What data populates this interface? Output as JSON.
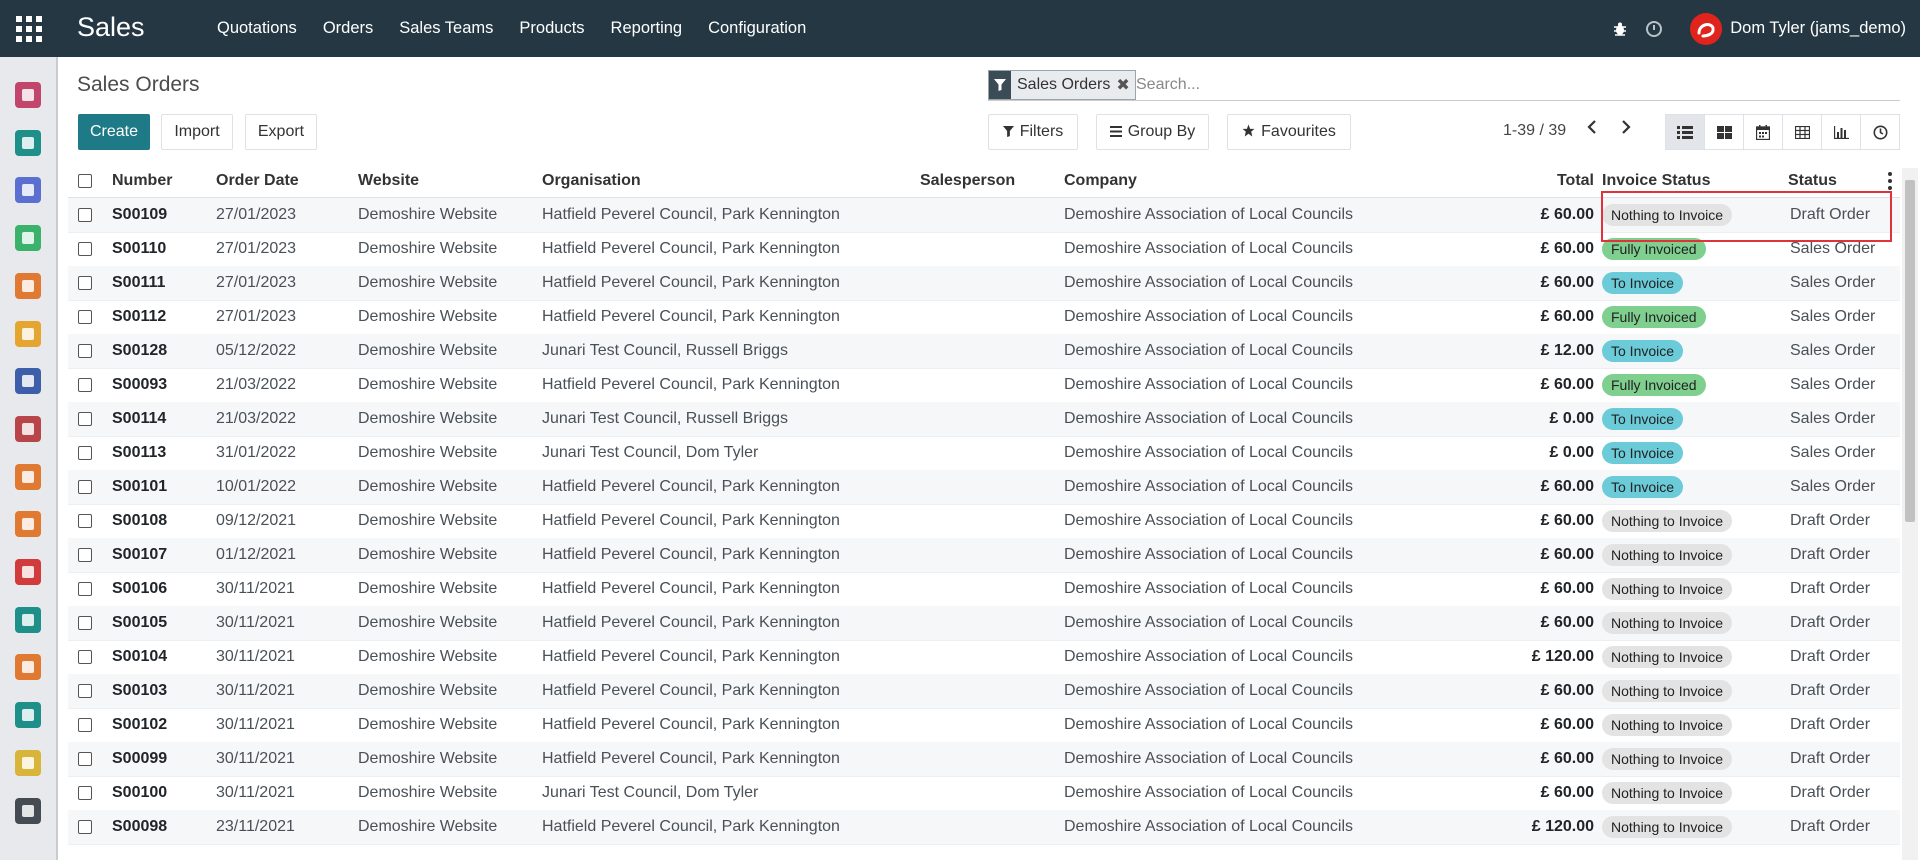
{
  "app": {
    "title": "Sales",
    "menu": [
      "Quotations",
      "Orders",
      "Sales Teams",
      "Products",
      "Reporting",
      "Configuration"
    ],
    "user": "Dom Tyler (jams_demo)"
  },
  "sidebar": {
    "items": [
      {
        "icon": "dashboard-icon",
        "color": "#c2466b"
      },
      {
        "icon": "contacts-icon",
        "color": "#1f8f8a"
      },
      {
        "icon": "team-icon",
        "color": "#5b6fd1"
      },
      {
        "icon": "members-icon",
        "color": "#3bb26b"
      },
      {
        "icon": "website-icon",
        "color": "#e07a33"
      },
      {
        "icon": "crm-icon",
        "color": "#e5a531"
      },
      {
        "icon": "knowledge-icon",
        "color": "#3d5ea8"
      },
      {
        "icon": "sales-icon",
        "color": "#b8454a"
      },
      {
        "icon": "reporting-icon",
        "color": "#e07a33"
      },
      {
        "icon": "invoicing-icon",
        "color": "#e07a33"
      },
      {
        "icon": "marketing-icon",
        "color": "#d23b3b"
      },
      {
        "icon": "pricing-icon",
        "color": "#1f8f8a"
      },
      {
        "icon": "surveys-icon",
        "color": "#e07a33"
      },
      {
        "icon": "employees-icon",
        "color": "#1f8f8a"
      },
      {
        "icon": "documents-icon",
        "color": "#d9b43a"
      },
      {
        "icon": "settings-icon",
        "color": "#444b52"
      }
    ]
  },
  "control": {
    "page_title": "Sales Orders",
    "facet_label": "Sales Orders",
    "facet_close": "✖",
    "search_placeholder": "Search...",
    "create_label": "Create",
    "import_label": "Import",
    "export_label": "Export",
    "filters_label": "Filters",
    "groupby_label": "Group By",
    "favourites_label": "Favourites",
    "pager": "1-39 / 39"
  },
  "table": {
    "headers": {
      "number": "Number",
      "order_date": "Order Date",
      "website": "Website",
      "organisation": "Organisation",
      "salesperson": "Salesperson",
      "company": "Company",
      "total": "Total",
      "invoice_status": "Invoice Status",
      "status": "Status"
    },
    "rows": [
      {
        "number": "S00109",
        "date": "27/01/2023",
        "website": "Demoshire Website",
        "org": "Hatfield Peverel Council, Park Kennington",
        "salesperson": "",
        "company": "Demoshire Association of Local Councils",
        "total": "£ 60.00",
        "invoice": "Nothing to Invoice",
        "status": "Draft Order"
      },
      {
        "number": "S00110",
        "date": "27/01/2023",
        "website": "Demoshire Website",
        "org": "Hatfield Peverel Council, Park Kennington",
        "salesperson": "",
        "company": "Demoshire Association of Local Councils",
        "total": "£ 60.00",
        "invoice": "Fully Invoiced",
        "status": "Sales Order"
      },
      {
        "number": "S00111",
        "date": "27/01/2023",
        "website": "Demoshire Website",
        "org": "Hatfield Peverel Council, Park Kennington",
        "salesperson": "",
        "company": "Demoshire Association of Local Councils",
        "total": "£ 60.00",
        "invoice": "To Invoice",
        "status": "Sales Order"
      },
      {
        "number": "S00112",
        "date": "27/01/2023",
        "website": "Demoshire Website",
        "org": "Hatfield Peverel Council, Park Kennington",
        "salesperson": "",
        "company": "Demoshire Association of Local Councils",
        "total": "£ 60.00",
        "invoice": "Fully Invoiced",
        "status": "Sales Order"
      },
      {
        "number": "S00128",
        "date": "05/12/2022",
        "website": "Demoshire Website",
        "org": "Junari Test Council, Russell Briggs",
        "salesperson": "",
        "company": "Demoshire Association of Local Councils",
        "total": "£ 12.00",
        "invoice": "To Invoice",
        "status": "Sales Order"
      },
      {
        "number": "S00093",
        "date": "21/03/2022",
        "website": "Demoshire Website",
        "org": "Hatfield Peverel Council, Park Kennington",
        "salesperson": "",
        "company": "Demoshire Association of Local Councils",
        "total": "£ 60.00",
        "invoice": "Fully Invoiced",
        "status": "Sales Order"
      },
      {
        "number": "S00114",
        "date": "21/03/2022",
        "website": "Demoshire Website",
        "org": "Junari Test Council, Russell Briggs",
        "salesperson": "",
        "company": "Demoshire Association of Local Councils",
        "total": "£ 0.00",
        "invoice": "To Invoice",
        "status": "Sales Order"
      },
      {
        "number": "S00113",
        "date": "31/01/2022",
        "website": "Demoshire Website",
        "org": "Junari Test Council, Dom Tyler",
        "salesperson": "",
        "company": "Demoshire Association of Local Councils",
        "total": "£ 0.00",
        "invoice": "To Invoice",
        "status": "Sales Order"
      },
      {
        "number": "S00101",
        "date": "10/01/2022",
        "website": "Demoshire Website",
        "org": "Hatfield Peverel Council, Park Kennington",
        "salesperson": "",
        "company": "Demoshire Association of Local Councils",
        "total": "£ 60.00",
        "invoice": "To Invoice",
        "status": "Sales Order"
      },
      {
        "number": "S00108",
        "date": "09/12/2021",
        "website": "Demoshire Website",
        "org": "Hatfield Peverel Council, Park Kennington",
        "salesperson": "",
        "company": "Demoshire Association of Local Councils",
        "total": "£ 60.00",
        "invoice": "Nothing to Invoice",
        "status": "Draft Order"
      },
      {
        "number": "S00107",
        "date": "01/12/2021",
        "website": "Demoshire Website",
        "org": "Hatfield Peverel Council, Park Kennington",
        "salesperson": "",
        "company": "Demoshire Association of Local Councils",
        "total": "£ 60.00",
        "invoice": "Nothing to Invoice",
        "status": "Draft Order"
      },
      {
        "number": "S00106",
        "date": "30/11/2021",
        "website": "Demoshire Website",
        "org": "Hatfield Peverel Council, Park Kennington",
        "salesperson": "",
        "company": "Demoshire Association of Local Councils",
        "total": "£ 60.00",
        "invoice": "Nothing to Invoice",
        "status": "Draft Order"
      },
      {
        "number": "S00105",
        "date": "30/11/2021",
        "website": "Demoshire Website",
        "org": "Hatfield Peverel Council, Park Kennington",
        "salesperson": "",
        "company": "Demoshire Association of Local Councils",
        "total": "£ 60.00",
        "invoice": "Nothing to Invoice",
        "status": "Draft Order"
      },
      {
        "number": "S00104",
        "date": "30/11/2021",
        "website": "Demoshire Website",
        "org": "Hatfield Peverel Council, Park Kennington",
        "salesperson": "",
        "company": "Demoshire Association of Local Councils",
        "total": "£ 120.00",
        "invoice": "Nothing to Invoice",
        "status": "Draft Order"
      },
      {
        "number": "S00103",
        "date": "30/11/2021",
        "website": "Demoshire Website",
        "org": "Hatfield Peverel Council, Park Kennington",
        "salesperson": "",
        "company": "Demoshire Association of Local Councils",
        "total": "£ 60.00",
        "invoice": "Nothing to Invoice",
        "status": "Draft Order"
      },
      {
        "number": "S00102",
        "date": "30/11/2021",
        "website": "Demoshire Website",
        "org": "Hatfield Peverel Council, Park Kennington",
        "salesperson": "",
        "company": "Demoshire Association of Local Councils",
        "total": "£ 60.00",
        "invoice": "Nothing to Invoice",
        "status": "Draft Order"
      },
      {
        "number": "S00099",
        "date": "30/11/2021",
        "website": "Demoshire Website",
        "org": "Hatfield Peverel Council, Park Kennington",
        "salesperson": "",
        "company": "Demoshire Association of Local Councils",
        "total": "£ 60.00",
        "invoice": "Nothing to Invoice",
        "status": "Draft Order"
      },
      {
        "number": "S00100",
        "date": "30/11/2021",
        "website": "Demoshire Website",
        "org": "Junari Test Council, Dom Tyler",
        "salesperson": "",
        "company": "Demoshire Association of Local Councils",
        "total": "£ 60.00",
        "invoice": "Nothing to Invoice",
        "status": "Draft Order"
      },
      {
        "number": "S00098",
        "date": "23/11/2021",
        "website": "Demoshire Website",
        "org": "Hatfield Peverel Council, Park Kennington",
        "salesperson": "",
        "company": "Demoshire Association of Local Councils",
        "total": "£ 120.00",
        "invoice": "Nothing to Invoice",
        "status": "Draft Order"
      }
    ]
  }
}
